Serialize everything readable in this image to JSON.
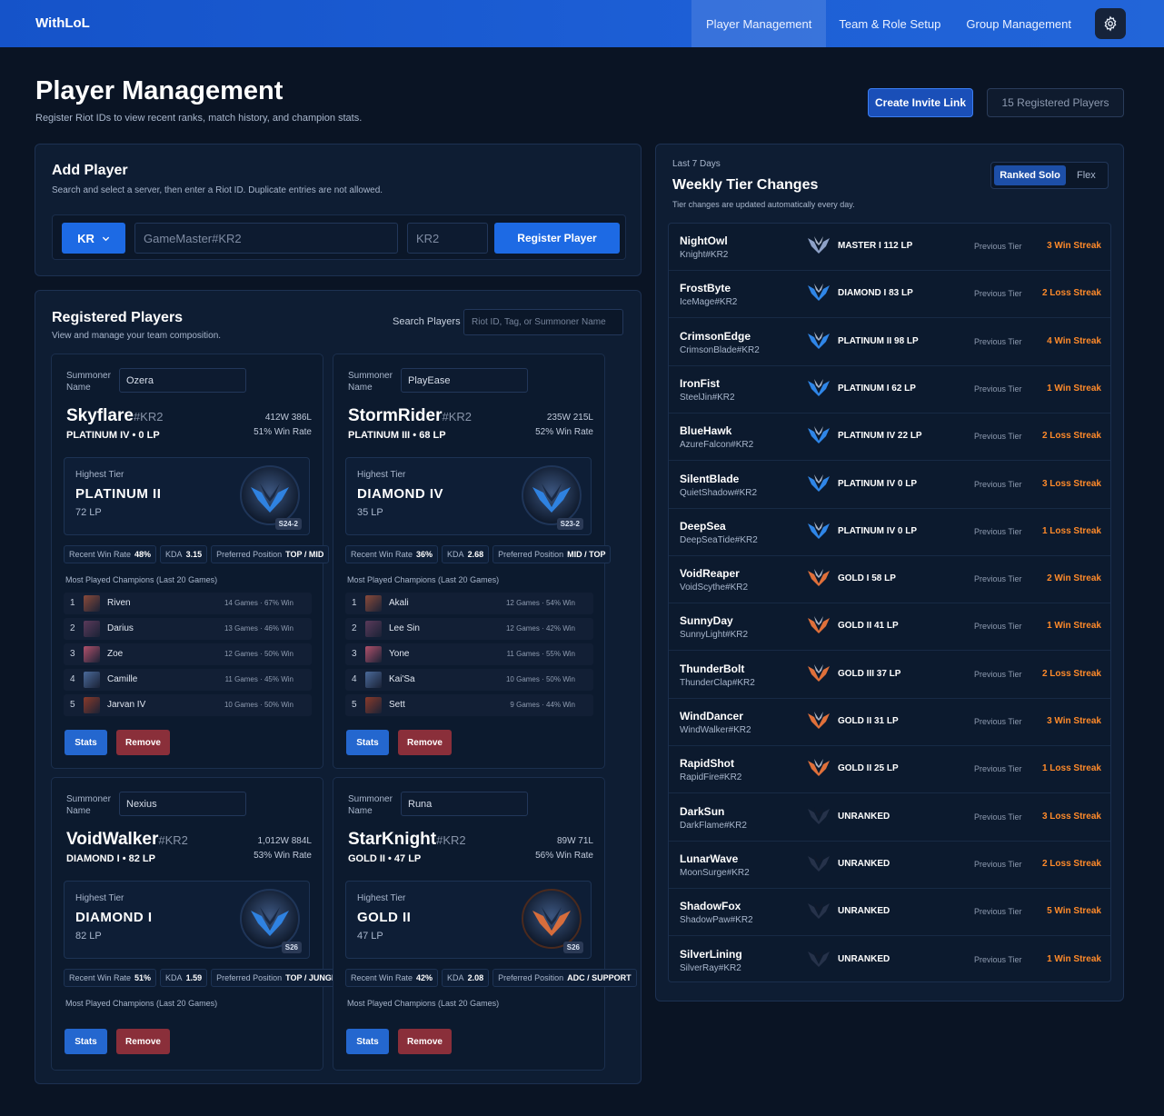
{
  "nav": {
    "brand": "WithLoL",
    "items": [
      "Player Management",
      "Team & Role Setup",
      "Group Management"
    ]
  },
  "header": {
    "title": "Player Management",
    "subtitle": "Register Riot IDs to view recent ranks, match history, and champion stats.",
    "invite_label": "Create Invite Link",
    "registered_count": "15 Registered Players"
  },
  "add_player": {
    "title": "Add Player",
    "subtitle": "Search and select a server, then enter a Riot ID. Duplicate entries are not allowed.",
    "server": "KR",
    "riot_id_placeholder": "GameMaster#KR2",
    "tag_placeholder": "KR2",
    "register_label": "Register Player"
  },
  "registered": {
    "title": "Registered Players",
    "subtitle": "View and manage your team composition.",
    "search_label": "Search Players",
    "search_placeholder": "Riot ID, Tag, or Summoner Name",
    "summoner_label": "Summoner Name",
    "highest_tier_label": "Highest Tier",
    "recent_wr_label": "Recent Win Rate",
    "kda_label": "KDA",
    "pref_pos_label": "Preferred Position",
    "most_played_label": "Most Played Champions (Last 20 Games)",
    "stats_label": "Stats",
    "remove_label": "Remove",
    "cards": [
      {
        "summoner": "Ozera",
        "name": "Skyflare",
        "tag": "#KR2",
        "rank": "PLATINUM IV • 0 LP",
        "wl": "412W 386L",
        "winrate": "51% Win Rate",
        "hi_tier": "PLATINUM II",
        "hi_lp": "72 LP",
        "season": "S24-2",
        "recent_wr": "48%",
        "kda": "3.15",
        "position": "TOP / MID",
        "champions": [
          {
            "rank": "1",
            "name": "Riven",
            "games": "14 Games · 67% Win"
          },
          {
            "rank": "2",
            "name": "Darius",
            "games": "13 Games · 46% Win"
          },
          {
            "rank": "3",
            "name": "Zoe",
            "games": "12 Games · 50% Win"
          },
          {
            "rank": "4",
            "name": "Camille",
            "games": "11 Games · 45% Win"
          },
          {
            "rank": "5",
            "name": "Jarvan IV",
            "games": "10 Games · 50% Win"
          }
        ]
      },
      {
        "summoner": "PlayEase",
        "name": "StormRider",
        "tag": "#KR2",
        "rank": "PLATINUM III • 68 LP",
        "wl": "235W 215L",
        "winrate": "52% Win Rate",
        "hi_tier": "DIAMOND IV",
        "hi_lp": "35 LP",
        "season": "S23-2",
        "recent_wr": "36%",
        "kda": "2.68",
        "position": "MID / TOP",
        "champions": [
          {
            "rank": "1",
            "name": "Akali",
            "games": "12 Games · 54% Win"
          },
          {
            "rank": "2",
            "name": "Lee Sin",
            "games": "12 Games · 42% Win"
          },
          {
            "rank": "3",
            "name": "Yone",
            "games": "11 Games · 55% Win"
          },
          {
            "rank": "4",
            "name": "Kai'Sa",
            "games": "10 Games · 50% Win"
          },
          {
            "rank": "5",
            "name": "Sett",
            "games": "9 Games · 44% Win"
          }
        ]
      },
      {
        "summoner": "Nexius",
        "name": "VoidWalker",
        "tag": "#KR2",
        "rank": "DIAMOND I • 82 LP",
        "wl": "1,012W 884L",
        "winrate": "53% Win Rate",
        "hi_tier": "DIAMOND I",
        "hi_lp": "82 LP",
        "season": "S26",
        "recent_wr": "51%",
        "kda": "1.59",
        "position": "TOP / JUNGLE",
        "champions": []
      },
      {
        "summoner": "Runa",
        "name": "StarKnight",
        "tag": "#KR2",
        "rank": "GOLD II • 47 LP",
        "wl": "89W 71L",
        "winrate": "56% Win Rate",
        "hi_tier": "GOLD II",
        "hi_lp": "47 LP",
        "season": "S26",
        "recent_wr": "42%",
        "kda": "2.08",
        "position": "ADC / SUPPORT",
        "champions": []
      }
    ]
  },
  "weekly": {
    "period": "Last 7 Days",
    "title": "Weekly Tier Changes",
    "subtitle": "Tier changes are updated automatically every day.",
    "tab_solo": "Ranked Solo",
    "tab_flex": "Flex",
    "prev_label": "Previous Tier",
    "rows": [
      {
        "name": "NightOwl",
        "riot_id": "Knight#KR2",
        "tier": "MASTER I 112 LP",
        "streak": "3 Win Streak",
        "kind": "master"
      },
      {
        "name": "FrostByte",
        "riot_id": "IceMage#KR2",
        "tier": "DIAMOND I 83 LP",
        "streak": "2 Loss Streak",
        "kind": "diamond"
      },
      {
        "name": "CrimsonEdge",
        "riot_id": "CrimsonBlade#KR2",
        "tier": "PLATINUM II 98 LP",
        "streak": "4 Win Streak",
        "kind": "platinum"
      },
      {
        "name": "IronFist",
        "riot_id": "SteelJin#KR2",
        "tier": "PLATINUM I 62 LP",
        "streak": "1 Win Streak",
        "kind": "platinum"
      },
      {
        "name": "BlueHawk",
        "riot_id": "AzureFalcon#KR2",
        "tier": "PLATINUM IV 22 LP",
        "streak": "2 Loss Streak",
        "kind": "platinum"
      },
      {
        "name": "SilentBlade",
        "riot_id": "QuietShadow#KR2",
        "tier": "PLATINUM IV 0 LP",
        "streak": "3 Loss Streak",
        "kind": "platinum"
      },
      {
        "name": "DeepSea",
        "riot_id": "DeepSeaTide#KR2",
        "tier": "PLATINUM IV 0 LP",
        "streak": "1 Loss Streak",
        "kind": "platinum"
      },
      {
        "name": "VoidReaper",
        "riot_id": "VoidScythe#KR2",
        "tier": "GOLD I 58 LP",
        "streak": "2 Win Streak",
        "kind": "gold"
      },
      {
        "name": "SunnyDay",
        "riot_id": "SunnyLight#KR2",
        "tier": "GOLD II 41 LP",
        "streak": "1 Win Streak",
        "kind": "gold"
      },
      {
        "name": "ThunderBolt",
        "riot_id": "ThunderClap#KR2",
        "tier": "GOLD III 37 LP",
        "streak": "2 Loss Streak",
        "kind": "gold"
      },
      {
        "name": "WindDancer",
        "riot_id": "WindWalker#KR2",
        "tier": "GOLD II 31 LP",
        "streak": "3 Win Streak",
        "kind": "gold"
      },
      {
        "name": "RapidShot",
        "riot_id": "RapidFire#KR2",
        "tier": "GOLD II 25 LP",
        "streak": "1 Loss Streak",
        "kind": "gold"
      },
      {
        "name": "DarkSun",
        "riot_id": "DarkFlame#KR2",
        "tier": "UNRANKED",
        "streak": "3 Loss Streak",
        "kind": "unranked"
      },
      {
        "name": "LunarWave",
        "riot_id": "MoonSurge#KR2",
        "tier": "UNRANKED",
        "streak": "2 Loss Streak",
        "kind": "unranked"
      },
      {
        "name": "ShadowFox",
        "riot_id": "ShadowPaw#KR2",
        "tier": "UNRANKED",
        "streak": "5 Win Streak",
        "kind": "unranked"
      },
      {
        "name": "SilverLining",
        "riot_id": "SilverRay#KR2",
        "tier": "UNRANKED",
        "streak": "1 Win Streak",
        "kind": "unranked"
      }
    ]
  },
  "colors": {
    "accent": "#1d6ae4",
    "streak": "#ff8a2a",
    "remove": "#8a2f3a",
    "platinum": "#2f86e8",
    "gold": "#e0703a",
    "master": "#8ea2c8",
    "unranked": "#1a2236"
  }
}
